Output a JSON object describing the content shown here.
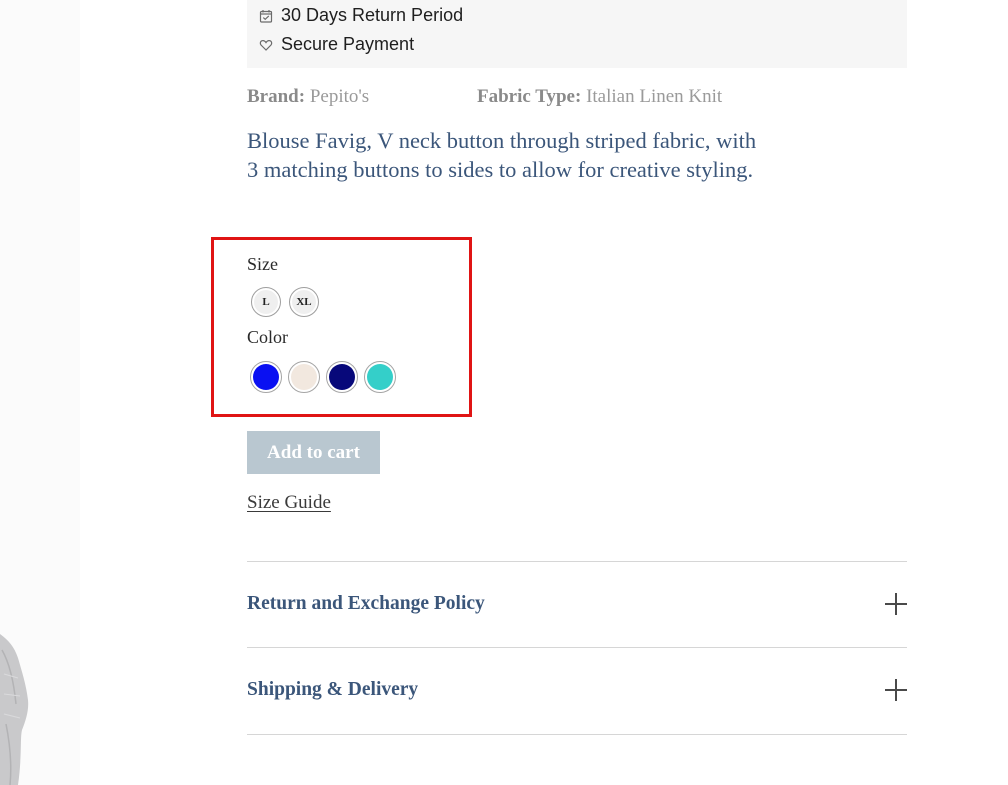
{
  "perks": [
    {
      "icon": "calendar-check-icon",
      "label": "30 Days Return Period"
    },
    {
      "icon": "heart-icon",
      "label": "Secure Payment"
    }
  ],
  "specs": {
    "brand_label": "Brand:",
    "brand_value": "Pepito's",
    "fabric_label": "Fabric Type:",
    "fabric_value": "Italian Linen Knit"
  },
  "description": "Blouse Favig, V neck button through striped fabric, with 3 matching buttons to sides to allow for creative styling.",
  "options": {
    "size_label": "Size",
    "sizes": [
      "L",
      "XL"
    ],
    "color_label": "Color",
    "colors": [
      "#0a10f2",
      "#f2e8df",
      "#07087a",
      "#34cfc9"
    ]
  },
  "actions": {
    "add_to_cart": "Add to cart",
    "size_guide": "Size Guide"
  },
  "accordions": [
    {
      "title": "Return and Exchange Policy",
      "icon": "plus-icon"
    },
    {
      "title": "Shipping & Delivery",
      "icon": "plus-icon"
    }
  ],
  "colors": {
    "accent": "#3b567a",
    "highlight": "#e01414",
    "button_disabled": "#b9c7d0"
  }
}
